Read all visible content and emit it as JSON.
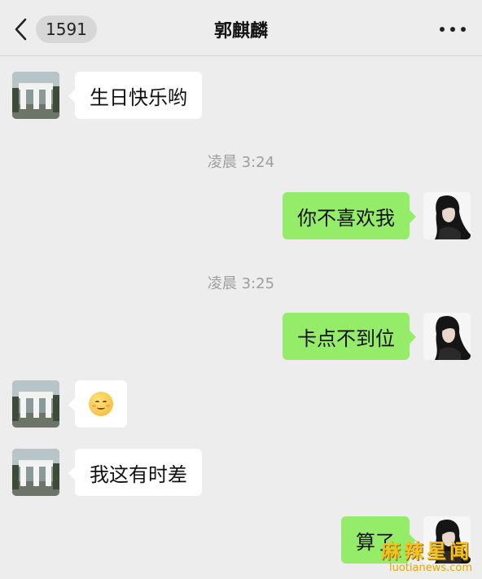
{
  "header": {
    "unread_count": "1591",
    "contact_name": "郭麒麟"
  },
  "messages": [
    {
      "side": "in",
      "type": "text",
      "text": "生日快乐哟"
    },
    {
      "type": "time",
      "text": "凌晨 3:24"
    },
    {
      "side": "out",
      "type": "text",
      "text": "你不喜欢我"
    },
    {
      "type": "time",
      "text": "凌晨 3:25"
    },
    {
      "side": "out",
      "type": "text",
      "text": "卡点不到位"
    },
    {
      "side": "in",
      "type": "emoji",
      "emoji": "smile-emoji"
    },
    {
      "side": "in",
      "type": "text",
      "text": "我这有时差"
    },
    {
      "side": "out",
      "type": "text",
      "text": "算了"
    }
  ],
  "colors": {
    "background": "#ededed",
    "incoming_bubble": "#ffffff",
    "outgoing_bubble": "#95ec69",
    "timestamp": "#9d9d9d"
  },
  "icons": [
    "back-chevron-icon",
    "more-dots-icon"
  ],
  "watermark": {
    "main": "麻辣星闻",
    "sub": "luotianews.com"
  }
}
